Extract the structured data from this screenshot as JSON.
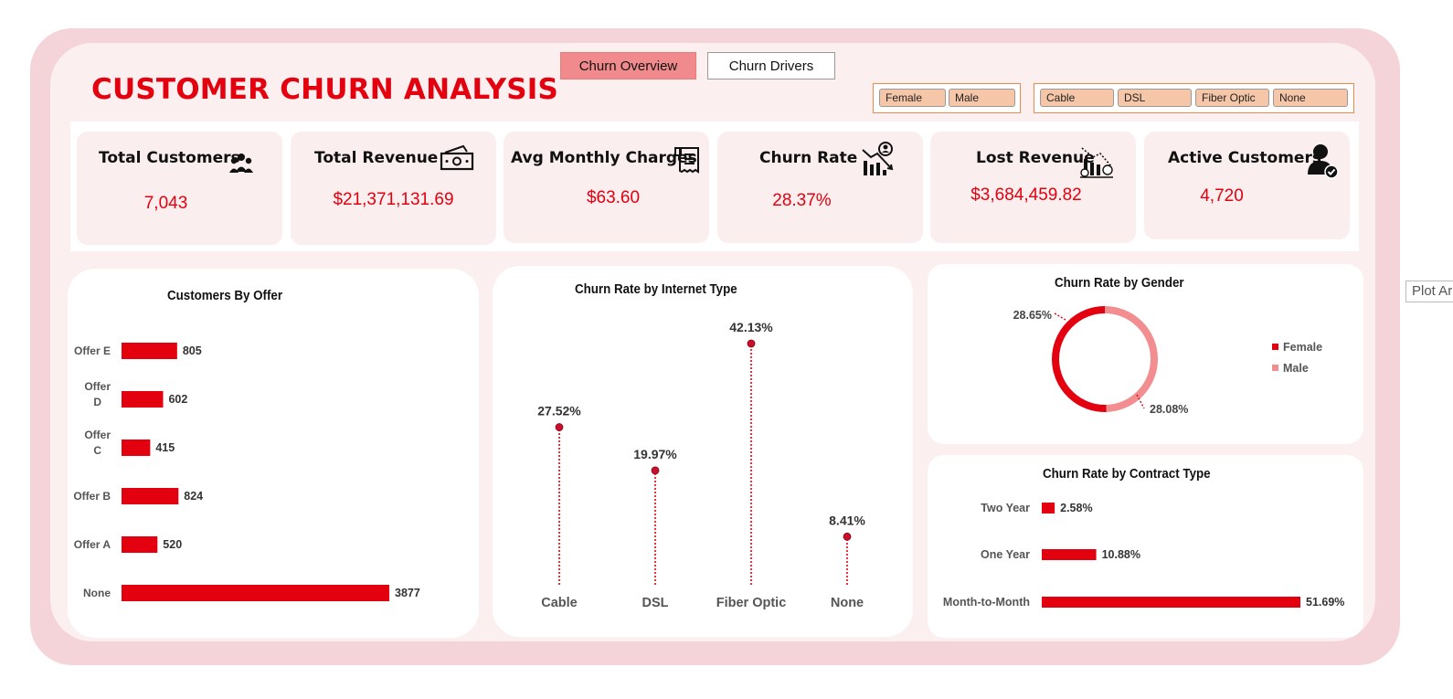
{
  "title": "CUSTOMER CHURN ANALYSIS",
  "tabs": [
    {
      "label": "Churn Overview",
      "active": true
    },
    {
      "label": "Churn Drivers",
      "active": false
    }
  ],
  "slicers": {
    "gender": [
      "Female",
      "Male"
    ],
    "internet_type": [
      "Cable",
      "DSL",
      "Fiber Optic",
      "None"
    ]
  },
  "kpis": [
    {
      "label": "Total Customers",
      "value": "7,043",
      "icon": "people-group-icon"
    },
    {
      "label": "Total Revenue",
      "value": "$21,371,131.69",
      "icon": "cash-icon"
    },
    {
      "label": "Avg Monthly Charges",
      "value": "$63.60",
      "icon": "receipt-icon"
    },
    {
      "label": "Churn Rate",
      "value": "28.37%",
      "icon": "declining-chart-person-icon"
    },
    {
      "label": "Lost Revenue",
      "value": "$3,684,459.82",
      "icon": "declining-revenue-icon"
    },
    {
      "label": "Active Customers",
      "value": "4,720",
      "icon": "user-check-icon"
    }
  ],
  "accent_color": "#e3000f",
  "secondary_color": "#f28d90",
  "tooltip": "Plot Ar",
  "chart_data": [
    {
      "type": "bar",
      "orientation": "horizontal",
      "title": "Customers By Offer",
      "categories": [
        "Offer E",
        "Offer D",
        "Offer C",
        "Offer B",
        "Offer A",
        "None"
      ],
      "values": [
        805,
        602,
        415,
        824,
        520,
        3877
      ],
      "labels": [
        "805",
        "602",
        "415",
        "824",
        "520",
        "3877"
      ]
    },
    {
      "type": "line",
      "style": "lollipop",
      "title": "Churn Rate by Internet Type",
      "categories": [
        "Cable",
        "DSL",
        "Fiber Optic",
        "None"
      ],
      "values": [
        27.52,
        19.97,
        42.13,
        8.41
      ],
      "labels": [
        "27.52%",
        "19.97%",
        "42.13%",
        "8.41%"
      ]
    },
    {
      "type": "pie",
      "style": "doughnut",
      "title": "Churn Rate by Gender",
      "categories": [
        "Female",
        "Male"
      ],
      "values": [
        28.65,
        28.08
      ],
      "labels": [
        "28.65%",
        "28.08%"
      ],
      "colors": [
        "#e3000f",
        "#f28d90"
      ],
      "legend": "right"
    },
    {
      "type": "bar",
      "orientation": "horizontal",
      "title": "Churn Rate by Contract Type",
      "categories": [
        "Two Year",
        "One Year",
        "Month-to-Month"
      ],
      "values": [
        2.58,
        10.88,
        51.69
      ],
      "labels": [
        "2.58%",
        "10.88%",
        "51.69%"
      ]
    }
  ]
}
